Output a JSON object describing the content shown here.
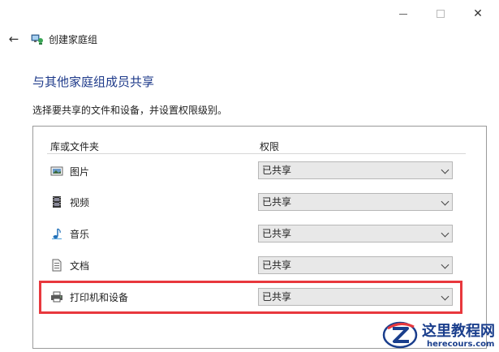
{
  "window": {
    "title": "创建家庭组",
    "back_glyph": "←",
    "close_glyph": "✕"
  },
  "page": {
    "heading": "与其他家庭组成员共享",
    "description": "选择要共享的文件和设备，并设置权限级别。"
  },
  "table": {
    "col_library": "库或文件夹",
    "col_permission": "权限",
    "rows": [
      {
        "label": "图片",
        "icon": "pictures-icon",
        "permission": "已共享"
      },
      {
        "label": "视频",
        "icon": "videos-icon",
        "permission": "已共享"
      },
      {
        "label": "音乐",
        "icon": "music-icon",
        "permission": "已共享"
      },
      {
        "label": "文档",
        "icon": "documents-icon",
        "permission": "已共享"
      },
      {
        "label": "打印机和设备",
        "icon": "printer-icon",
        "permission": "已共享"
      }
    ]
  },
  "watermark": {
    "name": "这里教程网",
    "url": "herecours.com"
  },
  "colors": {
    "heading": "#1e3a8a",
    "highlight": "#e8383d",
    "select_bg": "#e8e8e8",
    "watermark": "#1a3e8c"
  }
}
